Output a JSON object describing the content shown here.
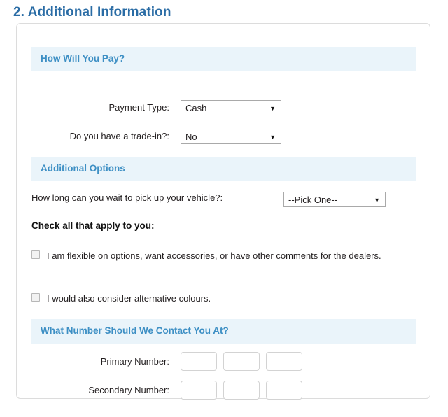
{
  "page": {
    "title": "2. Additional Information",
    "title_color": "#2a6ca5",
    "band_bg": "#eaf4fa",
    "band_text_color": "#3d8fc4"
  },
  "sections": {
    "payment": {
      "header": "How Will You Pay?",
      "fields": [
        {
          "label": "Payment Type:",
          "control": "select",
          "value": "Cash",
          "arrow": "▼"
        },
        {
          "label": "Do you have a trade-in?:",
          "control": "select",
          "value": "No",
          "arrow": "▼"
        }
      ]
    },
    "additional_options": {
      "header": "Additional Options",
      "wait_question": {
        "label": "How long can you wait to pick up your vehicle?:",
        "control": "select",
        "value": "--Pick One--",
        "arrow": "▼"
      },
      "check_prompt": "Check all that apply to you:",
      "checkboxes": [
        {
          "label": "I am flexible on options, want accessories, or have other comments for the dealers.",
          "checked": false
        },
        {
          "label": "I would also consider alternative colours.",
          "checked": false
        }
      ]
    },
    "contact": {
      "header": "What Number Should We Contact You At?",
      "rows": [
        {
          "label": "Primary Number:",
          "parts": [
            "",
            "",
            ""
          ]
        },
        {
          "label": "Secondary Number:",
          "parts": [
            "",
            "",
            ""
          ]
        }
      ]
    }
  }
}
